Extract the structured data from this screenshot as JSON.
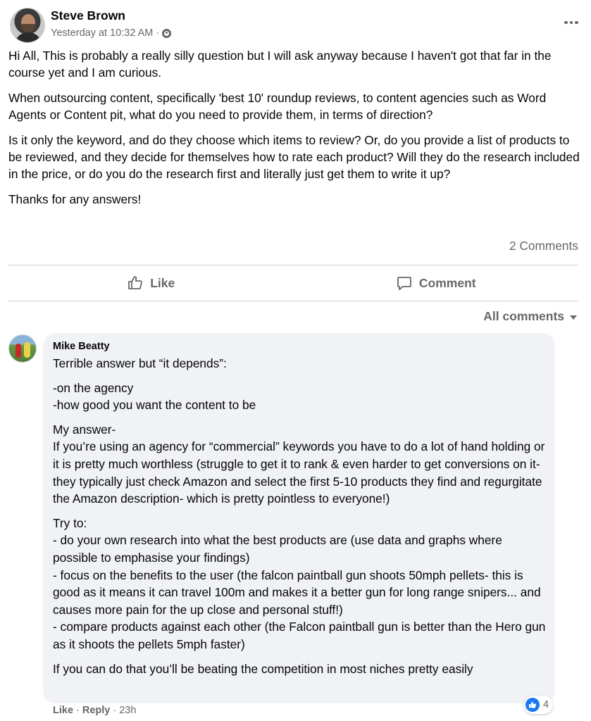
{
  "post": {
    "author": "Steve Brown",
    "timestamp": "Yesterday at 10:32 AM ·",
    "paragraphs": [
      "Hi All, This is probably a really silly question but I will ask anyway because I haven't got that far in the course yet and I am curious.",
      "When outsourcing content, specifically 'best 10' roundup reviews, to content agencies such as Word Agents or Content pit, what do you need to provide them, in terms of direction?",
      "Is it only the keyword, and do they choose which items to review? Or, do you provide a list of products to be reviewed, and they decide for themselves how to rate each product? Will they do the research included in the price, or do you do the research first and literally just get them to write it up?",
      "Thanks for any answers!"
    ],
    "comments_count": "2 Comments"
  },
  "actions": {
    "like_label": "Like",
    "comment_label": "Comment"
  },
  "filter": {
    "all_comments_label": "All comments"
  },
  "comment": {
    "author": "Mike Beatty",
    "lines": {
      "intro": "Terrible answer but “it depends”:",
      "dep1": "-on the agency",
      "dep2": "-how good you want the content to be",
      "answer_head": "My answer-",
      "answer_body": "If you’re using an agency for “commercial” keywords you have to do a lot of hand holding or it is pretty much worthless (struggle to get it to rank & even harder to get conversions on it- they typically just check Amazon and select the first 5-10 products they find and regurgitate the Amazon description- which is pretty pointless to everyone!)",
      "try_head": "Try to:",
      "try1": "- do your own research into what the best products are (use data and graphs where possible to emphasise your findings)",
      "try2": "- focus on the benefits to the user (the falcon paintball gun shoots 50mph pellets- this is good as it means it can travel 100m and makes it a better gun for long range snipers... and causes more pain for the up close and personal stuff!)",
      "try3": "- compare products against each other (the Falcon paintball gun is better than the Hero gun as it shoots the pellets 5mph faster)",
      "closing": "If you can do that you’ll be beating the competition in most niches pretty easily"
    },
    "like_label": "Like",
    "reply_label": "Reply",
    "separator": "·",
    "age": "23h",
    "reaction_count": "4"
  },
  "colors": {
    "text_primary": "#050505",
    "text_secondary": "#65676b",
    "bubble_bg": "#f0f2f5",
    "divider": "#ced0d4",
    "like_blue": "#1877f2"
  }
}
